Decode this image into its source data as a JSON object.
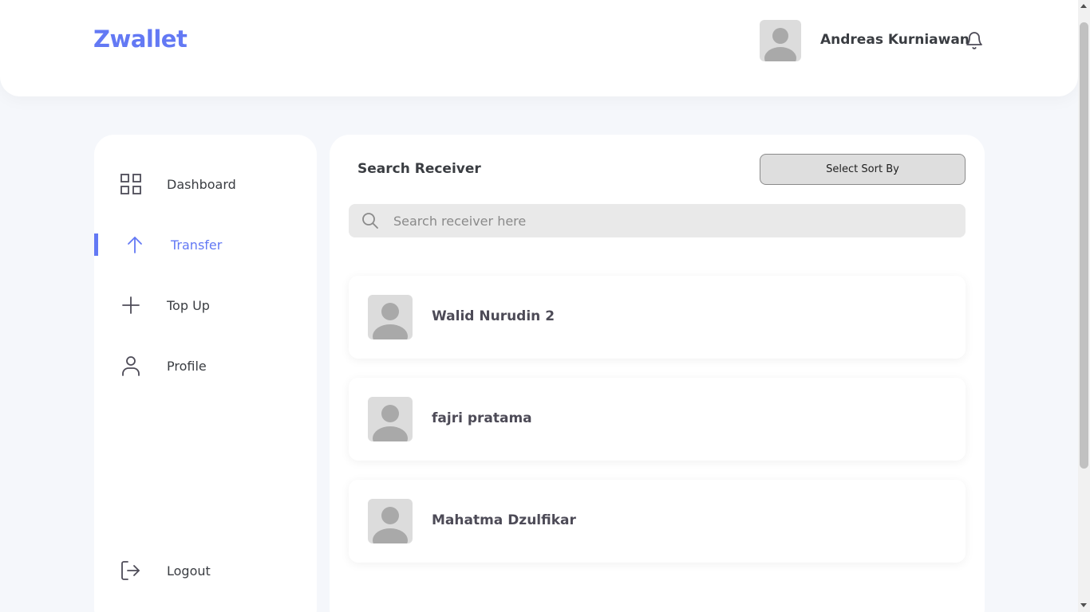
{
  "header": {
    "logo": "Zwallet",
    "user_name": "Andreas Kurniawan",
    "avatar_icon": "user-avatar-placeholder",
    "notification_icon": "bell-icon"
  },
  "sidebar": {
    "items": [
      {
        "label": "Dashboard",
        "icon": "grid-icon",
        "active": false
      },
      {
        "label": "Transfer",
        "icon": "arrow-up-icon",
        "active": true
      },
      {
        "label": "Top Up",
        "icon": "plus-icon",
        "active": false
      },
      {
        "label": "Profile",
        "icon": "user-icon",
        "active": false
      }
    ],
    "logout": {
      "label": "Logout",
      "icon": "logout-icon"
    }
  },
  "main": {
    "title": "Search Receiver",
    "sort_button_label": "Select Sort By",
    "search": {
      "placeholder": "Search receiver here",
      "value": ""
    },
    "receivers": [
      {
        "name": "Walid Nurudin 2"
      },
      {
        "name": "fajri pratama"
      },
      {
        "name": "Mahatma Dzulfikar"
      }
    ]
  },
  "colors": {
    "accent": "#6379F4",
    "background": "#f5f7fb",
    "text": "#3a3d42"
  }
}
